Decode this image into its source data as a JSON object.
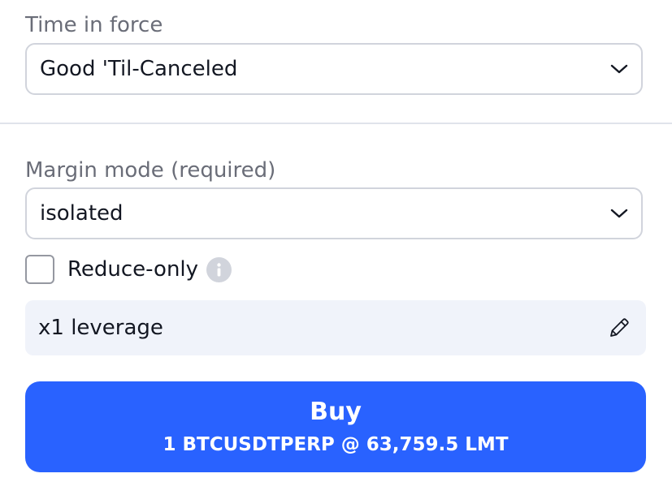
{
  "time_in_force": {
    "label": "Time in force",
    "value": "Good 'Til-Canceled"
  },
  "margin_mode": {
    "label": "Margin mode (required)",
    "value": "isolated"
  },
  "reduce_only": {
    "label": "Reduce-only",
    "checked": false
  },
  "leverage": {
    "text": "x1 leverage"
  },
  "buy_button": {
    "title": "Buy",
    "subtitle": "1 BTCUSDTPERP @ 63,759.5 LMT"
  },
  "colors": {
    "accent": "#2962ff",
    "border": "#d1d4dc",
    "label": "#6a6d78",
    "leverage_bg": "#f0f3fa"
  }
}
